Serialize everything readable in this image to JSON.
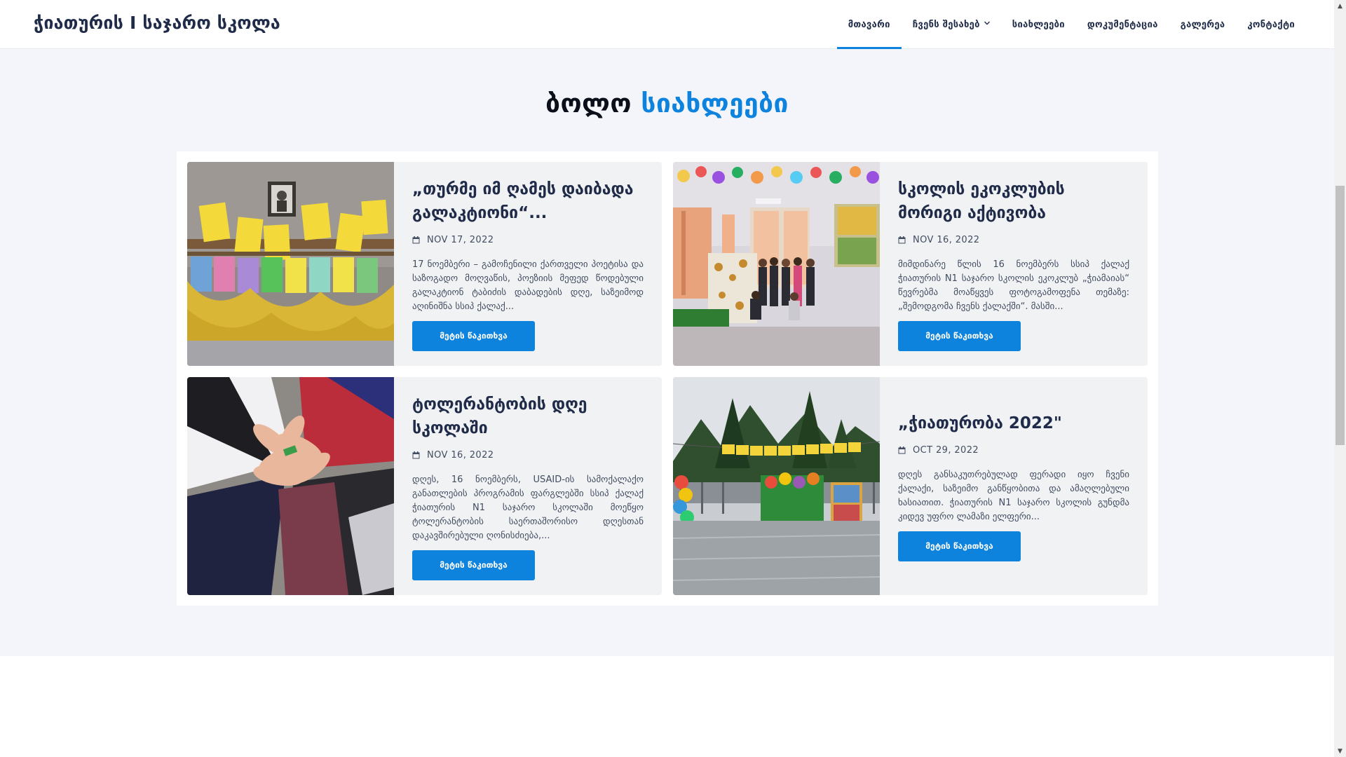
{
  "brand": "ჭიათურის I საჯარო სკოლა",
  "nav": [
    {
      "label": "მთავარი",
      "active": true,
      "has_dropdown": false
    },
    {
      "label": "ჩვენს შესახებ",
      "active": false,
      "has_dropdown": true
    },
    {
      "label": "სიახლეები",
      "active": false,
      "has_dropdown": false
    },
    {
      "label": "დოკუმენტაცია",
      "active": false,
      "has_dropdown": false
    },
    {
      "label": "გალერეა",
      "active": false,
      "has_dropdown": false
    },
    {
      "label": "კონტაქტი",
      "active": false,
      "has_dropdown": false
    }
  ],
  "section": {
    "title_part1": "ბოლო ",
    "title_part2": "სიახლეები"
  },
  "news": [
    {
      "title": "„თურმე იმ ღამეს დაიბადა გალაკტიონი“...",
      "date": "NOV 17, 2022",
      "excerpt": "17 ნოემბერი – გამოჩენილი ქართველი პოეტისა და საზოგადო მოღვაწის, პოეზიის მეფედ წოდებული გალაკტიონ ტაბიძის დაბადების დღე, საზეიმოდ აღინიშნა სსიპ ქალაქ...",
      "button": "მეტის წაკითხვა",
      "image": "poems-on-wall-photo"
    },
    {
      "title": "სკოლის ეკოკლუბის მორიგი აქტივობა",
      "date": "NOV 16, 2022",
      "excerpt": "მიმდინარე წლის 16 ნოემბერს სსიპ ქალაქ ჭიათურის N1 საჯარო სკოლის ეკოკლუბ „ჭიამაიას“ წევრებმა მოაწყვეს ფოტოგამოფენა თემაზე: „შემოდგომა ჩვენს ქალაქში“. მასში...",
      "button": "მეტის წაკითხვა",
      "image": "eco-club-group-photo"
    },
    {
      "title": "ტოლერანტობის დღე სკოლაში",
      "date": "NOV 16, 2022",
      "excerpt": "დღეს, 16 ნოემბერს, USAID-ის სამოქალაქო განათლების პროგრამის ფარგლებში სსიპ ქალაქ ჭიათურის N1 საჯარო სკოლაში მოეწყო ტოლერანტობის საერთაშორისო დღესთან დაკავშირებული ღონისძიება,...",
      "button": "მეტის წაკითხვა",
      "image": "joined-hands-photo"
    },
    {
      "title": "„ჭიათურობა 2022\"",
      "date": "OCT 29, 2022",
      "excerpt": "დღეს განსაკუთრებულად ფერადი იყო ჩვენი ქალაქი, საზეიმო განწყობითა და ამაღლებული ხასიათით. ჭიათურის N1 საჯარო სკოლის გუნდმა კიდევ უფრო ლამაზი ელფერი...",
      "button": "მეტის წაკითხვა",
      "image": "city-festival-photo"
    }
  ],
  "colors": {
    "accent": "#0d83dd",
    "heading": "#1f2b48",
    "section_bg": "#f3f5fa",
    "card_bg": "#f1f2f4"
  },
  "icons": {
    "date": "calendar-icon",
    "dropdown": "chevron-down-icon"
  }
}
